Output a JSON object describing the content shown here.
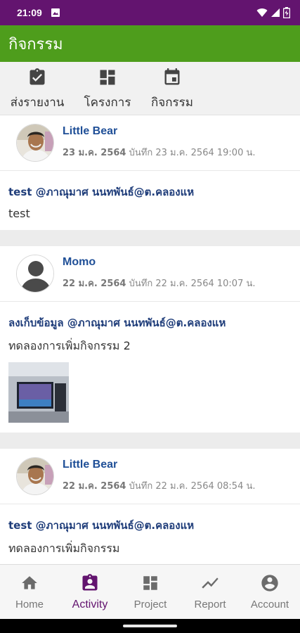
{
  "status_bar": {
    "time": "21:09",
    "icons": [
      "photo-icon",
      "wifi-icon",
      "signal-icon",
      "battery-icon"
    ]
  },
  "app_bar": {
    "title": "กิจกรรม"
  },
  "top_tabs": [
    {
      "label": "ส่งรายงาน",
      "icon": "assignment-check-icon"
    },
    {
      "label": "โครงการ",
      "icon": "dashboard-icon"
    },
    {
      "label": "กิจกรรม",
      "icon": "calendar-icon"
    }
  ],
  "posts": [
    {
      "author": "Little Bear",
      "date_bold": "23 ม.ค. 2564",
      "date_rest": "บันทึก 23 ม.ค. 2564 19:00 น.",
      "title": "test @ภาณุมาศ นนทพันธ์@ต.คลองแห",
      "text": "test",
      "avatar": "photo"
    },
    {
      "author": "Momo",
      "date_bold": "22 ม.ค. 2564",
      "date_rest": "บันทึก 22 ม.ค. 2564 10:07 น.",
      "title": "ลงเก็บข้อมูล @ภาณุมาศ นนทพันธ์@ต.คลองแห",
      "text": "ทดลองการเพิ่มกิจกรรม 2",
      "avatar": "default"
    },
    {
      "author": "Little Bear",
      "date_bold": "22 ม.ค. 2564",
      "date_rest": "บันทึก 22 ม.ค. 2564 08:54 น.",
      "title": "test @ภาณุมาศ นนทพันธ์@ต.คลองแห",
      "text": "ทดลองการเพิ่มกิจกรรม",
      "avatar": "photo"
    }
  ],
  "bottom_nav": [
    {
      "label": "Home",
      "icon": "home-icon",
      "active": false
    },
    {
      "label": "Activity",
      "icon": "clipboard-user-icon",
      "active": true
    },
    {
      "label": "Project",
      "icon": "dashboard-icon",
      "active": false
    },
    {
      "label": "Report",
      "icon": "trending-icon",
      "active": false
    },
    {
      "label": "Account",
      "icon": "account-circle-icon",
      "active": false
    }
  ],
  "colors": {
    "status_bar": "#63146f",
    "app_bar": "#4e9d1c",
    "author_link": "#1f4f97",
    "title_text": "#1f3d7a",
    "active_nav": "#63146f",
    "inactive_nav": "#777777"
  }
}
